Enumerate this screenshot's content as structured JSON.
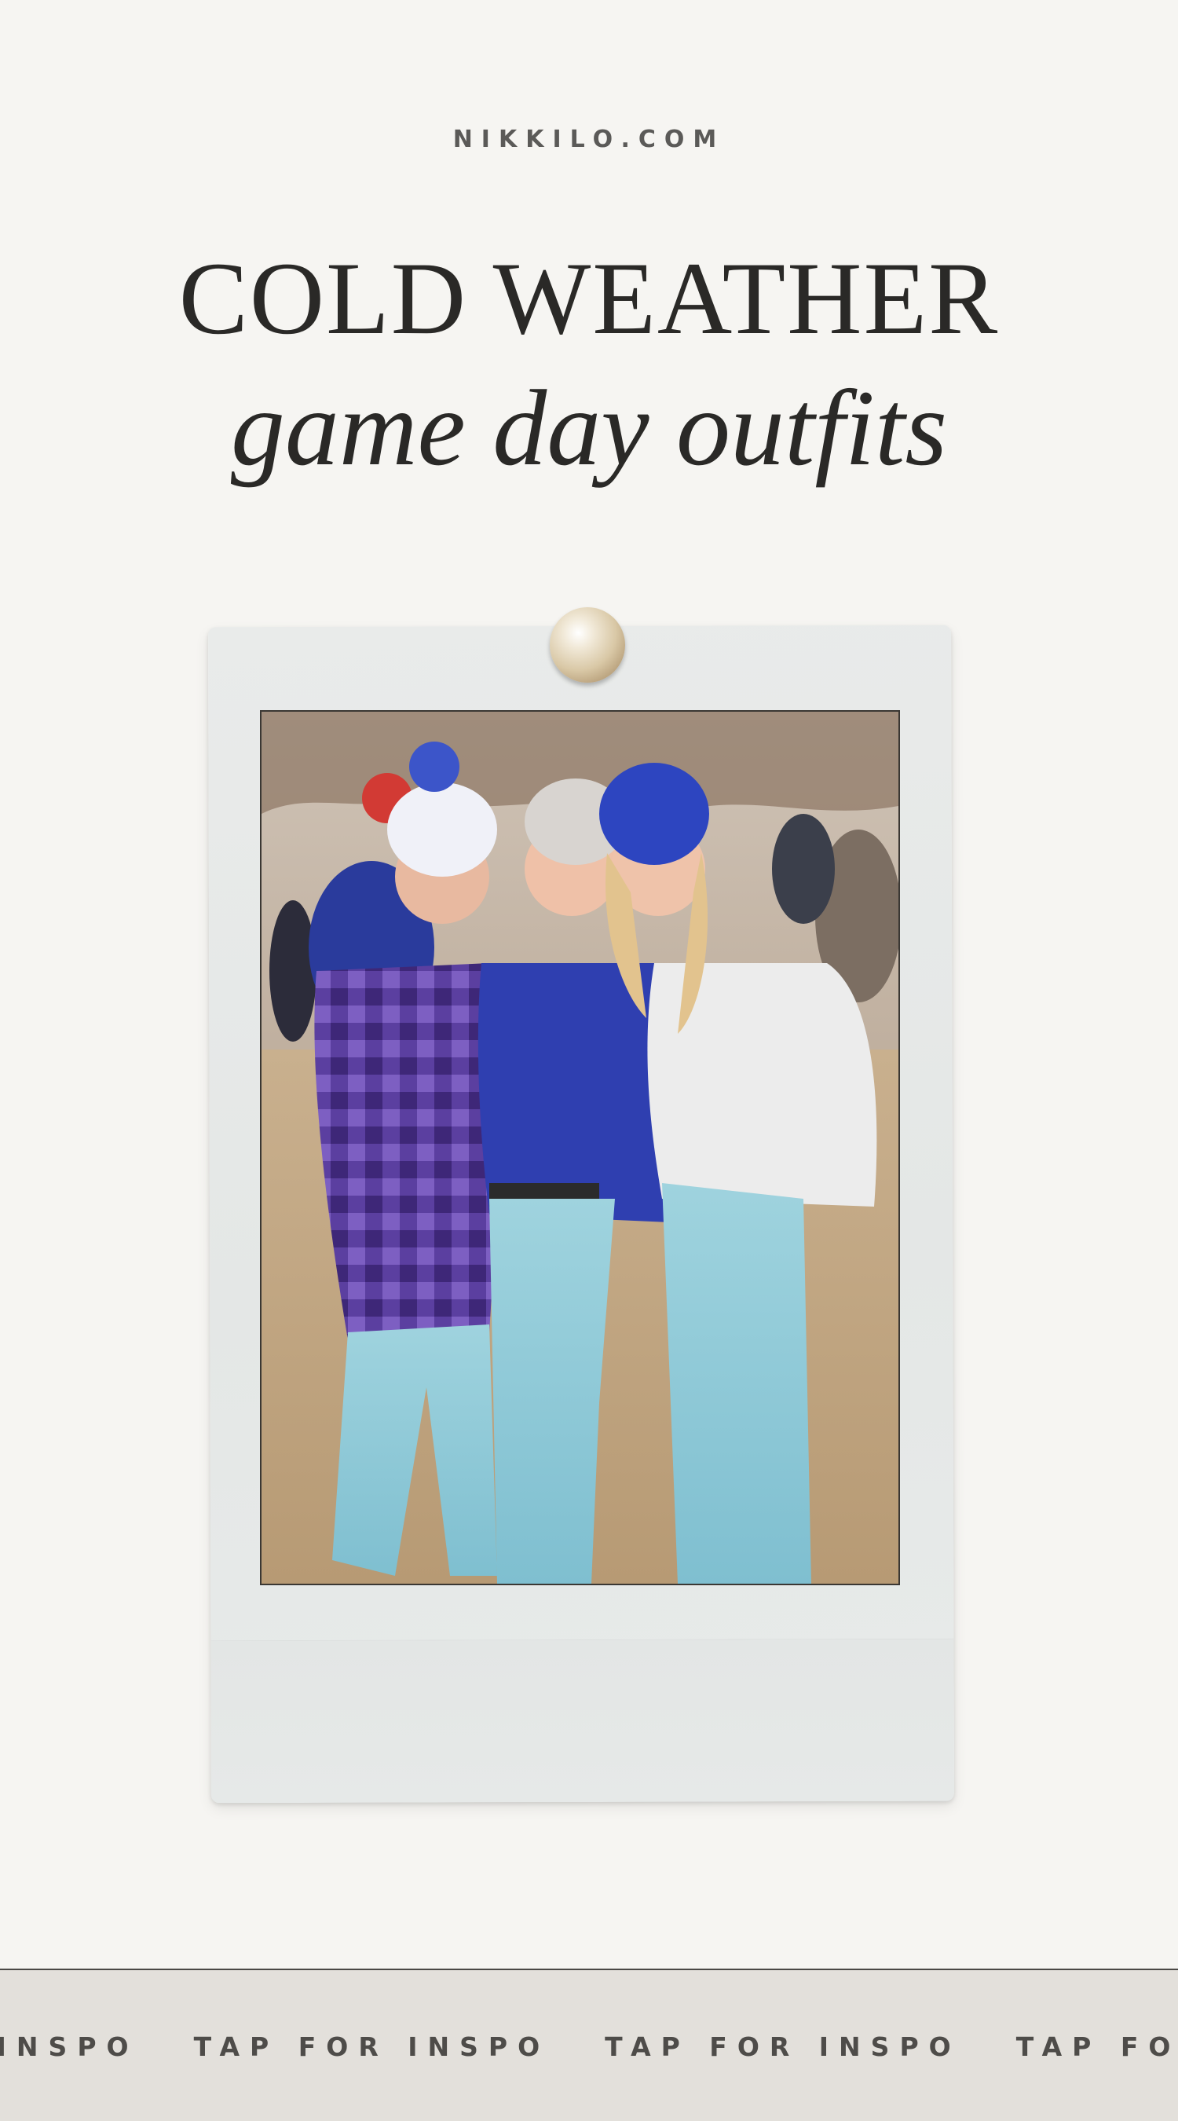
{
  "header": {
    "site_url": "NIKKILO.COM",
    "title_line1": "COLD WEATHER",
    "title_line2": "game day outfits"
  },
  "photo": {
    "subject": "three-friends-tcu-game-day-photo"
  },
  "ticker": {
    "items": [
      "TAP FOR INSPO",
      "TAP FOR INSPO",
      "TAP FOR INSPO",
      "TAP FOR INSPO"
    ]
  },
  "colors": {
    "background": "#f6f5f2",
    "ticker_background": "#e3e0db",
    "text": "#2a2927",
    "tcu_purple_blue": "#2f3fb0"
  }
}
